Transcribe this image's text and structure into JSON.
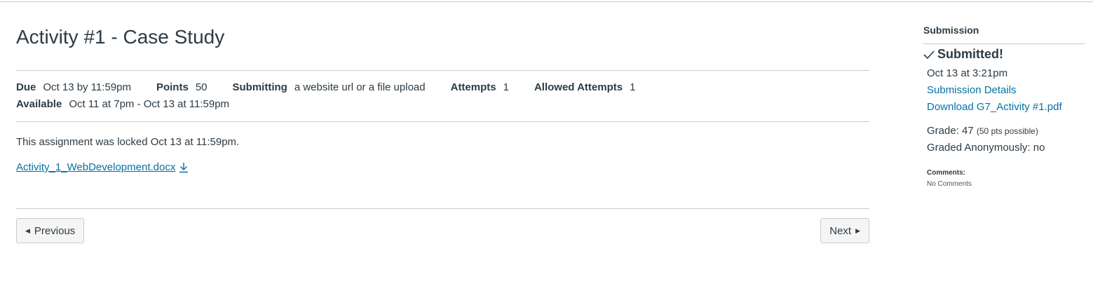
{
  "assignment": {
    "title": "Activity #1 - Case Study",
    "details": {
      "due_label": "Due",
      "due_value": "Oct 13 by 11:59pm",
      "points_label": "Points",
      "points_value": "50",
      "submitting_label": "Submitting",
      "submitting_value": "a website url or a file upload",
      "attempts_label": "Attempts",
      "attempts_value": "1",
      "allowed_label": "Allowed Attempts",
      "allowed_value": "1",
      "available_label": "Available",
      "available_value": "Oct 11 at 7pm - Oct 13 at 11:59pm"
    },
    "locked_message": "This assignment was locked Oct 13 at 11:59pm.",
    "attachment": "Activity_1_WebDevelopment.docx"
  },
  "nav": {
    "previous_label": "Previous",
    "next_label": "Next"
  },
  "submission": {
    "heading": "Submission",
    "status": "Submitted!",
    "date": "Oct 13 at 3:21pm",
    "details_link": "Submission Details",
    "download_link": "Download G7_Activity #1.pdf",
    "grade_text": "Grade: 47",
    "grade_possible": "(50 pts possible)",
    "graded_anon": "Graded Anonymously: no",
    "comments_label": "Comments:",
    "comments_value": "No Comments"
  },
  "colors": {
    "link": "#0770a3",
    "text": "#2d3b45",
    "divider": "#c7cdd1"
  }
}
